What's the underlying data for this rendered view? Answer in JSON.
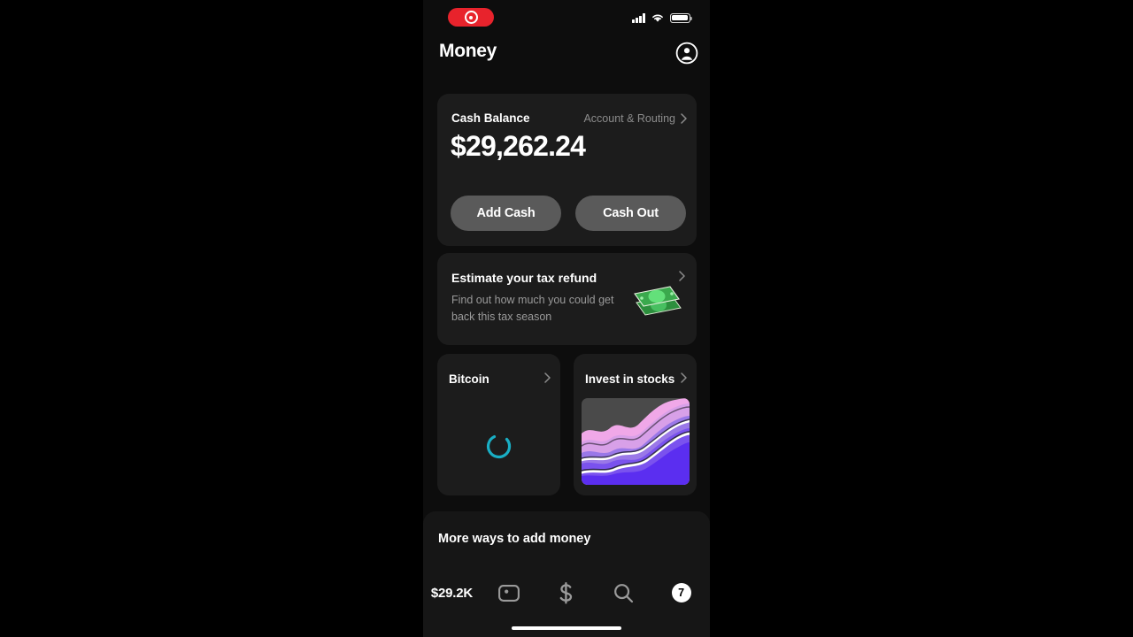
{
  "status_bar": {
    "recording_indicator": "record-pill",
    "signal": "cellular-signal-icon",
    "wifi": "wifi-icon",
    "battery": "battery-full-icon"
  },
  "header": {
    "title": "Money",
    "profile_icon": "account-circle-icon"
  },
  "cash_balance_card": {
    "label": "Cash Balance",
    "routing_link": "Account & Routing",
    "amount": "$29,262.24",
    "add_cash_label": "Add Cash",
    "cash_out_label": "Cash Out"
  },
  "tax_card": {
    "title": "Estimate your tax refund",
    "subtitle": "Find out how much you could get back this tax season",
    "art": "stacked-banknotes-emoji"
  },
  "bitcoin_card": {
    "title": "Bitcoin",
    "state": "loading-spinner"
  },
  "stocks_card": {
    "title": "Invest in stocks",
    "art": "layered-area-chart"
  },
  "bottom_sheet": {
    "title": "More ways to add money"
  },
  "tabbar": {
    "items": [
      {
        "label": "$29.2K",
        "icon": "money-balance-tab"
      },
      {
        "label": "",
        "icon": "card-icon"
      },
      {
        "label": "",
        "icon": "dollar-sign-icon"
      },
      {
        "label": "",
        "icon": "search-icon"
      },
      {
        "label": "7",
        "icon": "activity-badge-icon"
      }
    ]
  },
  "colors": {
    "background": "#0d0d0d",
    "card": "#1c1c1c",
    "sheet": "#161616",
    "pill_button": "#5a5a5a",
    "record_red": "#e8232c",
    "spinner_cyan": "#19aec4",
    "text_primary": "#ffffff",
    "text_secondary": "#9a9a9a",
    "money_green": "#3fbf54",
    "stock_pink": "#f0a8e0",
    "stock_violet": "#5b2ef0"
  }
}
